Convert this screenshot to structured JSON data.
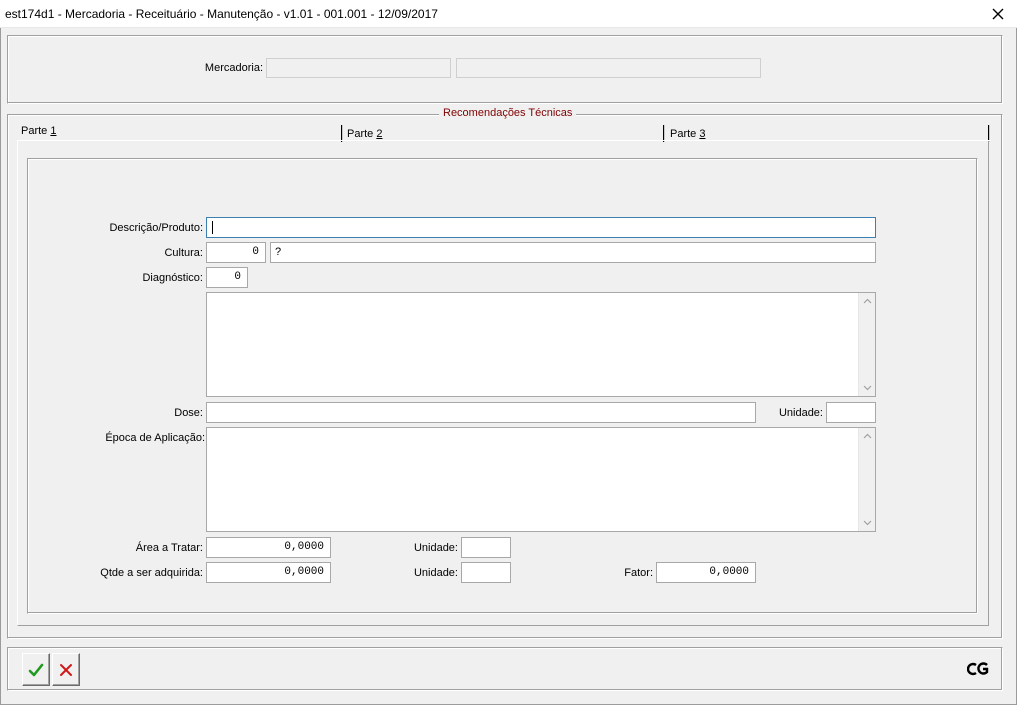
{
  "window": {
    "title": "est174d1 - Mercadoria - Receituário - Manutenção - v1.01 - 001.001 - 12/09/2017"
  },
  "header": {
    "mercadoria_label": "Mercadoria:",
    "mercadoria_code": "",
    "mercadoria_desc": ""
  },
  "group": {
    "caption": "Recomendações Técnicas"
  },
  "tabs": [
    {
      "prefix": "Parte ",
      "key": "1"
    },
    {
      "prefix": "Parte ",
      "key": "2"
    },
    {
      "prefix": "Parte ",
      "key": "3"
    }
  ],
  "form": {
    "descricao_label": "Descrição/Produto:",
    "descricao_value": "",
    "cultura_label": "Cultura:",
    "cultura_code": "0",
    "cultura_desc": "?",
    "diagnostico_label": "Diagnóstico:",
    "diagnostico_code": "0",
    "diagnostico_text": "",
    "dose_label": "Dose:",
    "dose_value": "",
    "dose_unidade_label": "Unidade:",
    "dose_unidade_value": "",
    "epoca_label": "Época de Aplicação:",
    "epoca_text": "",
    "area_label": "Área a Tratar:",
    "area_value": "0,0000",
    "area_unidade_label": "Unidade:",
    "area_unidade_value": "",
    "qtde_label": "Qtde a ser adquirida:",
    "qtde_value": "0,0000",
    "qtde_unidade_label": "Unidade:",
    "qtde_unidade_value": "",
    "fator_label": "Fator:",
    "fator_value": "0,0000"
  },
  "footer": {
    "brand": "CG"
  },
  "colors": {
    "confirm": "#1f9a1f",
    "cancel": "#d01818",
    "caption": "#800000",
    "focus": "#3c7fb1"
  }
}
